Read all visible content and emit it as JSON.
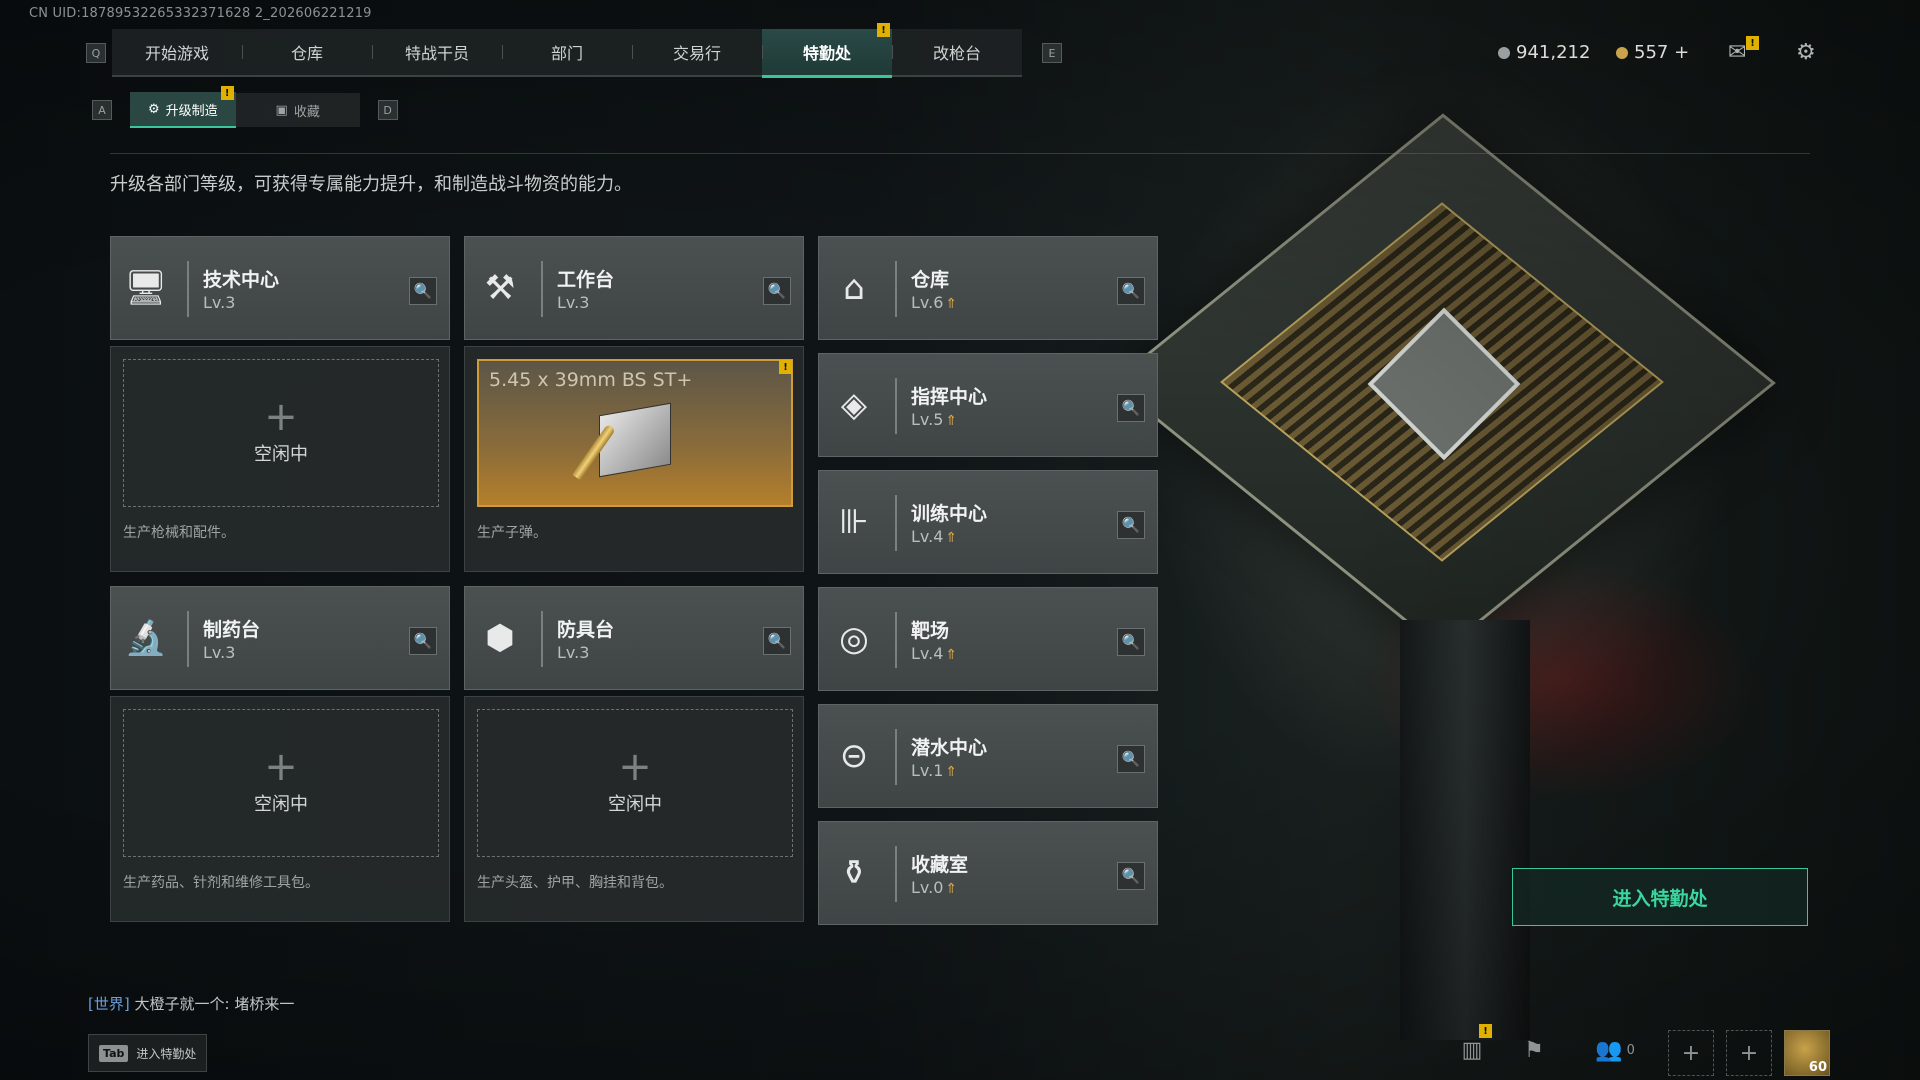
{
  "uid": "CN UID:18789532265332371628 2_202606221219",
  "nav": {
    "left_key": "Q",
    "right_key": "E",
    "tabs": [
      "开始游戏",
      "仓库",
      "特战干员",
      "部门",
      "交易行",
      "特勤处",
      "改枪台"
    ],
    "active_tab": "特勤处"
  },
  "currency": {
    "silver": "941,212",
    "gold": "557 +"
  },
  "subnav": {
    "left_key": "A",
    "right_key": "D",
    "tabs": [
      "升级制造",
      "收藏"
    ],
    "active": "升级制造"
  },
  "description": "升级各部门等级，可获得专属能力提升，和制造战斗物资的能力。",
  "departments": [
    {
      "name": "技术中心",
      "level": "Lv.3",
      "icon": "monitor-icon"
    },
    {
      "name": "工作台",
      "level": "Lv.3",
      "icon": "tools-icon"
    },
    {
      "name": "仓库",
      "level": "Lv.6",
      "icon": "warehouse-icon"
    },
    {
      "name": "指挥中心",
      "level": "Lv.5",
      "icon": "command-icon"
    },
    {
      "name": "训练中心",
      "level": "Lv.4",
      "icon": "dumbbell-icon"
    },
    {
      "name": "制药台",
      "level": "Lv.3",
      "icon": "microscope-icon"
    },
    {
      "name": "防具台",
      "level": "Lv.3",
      "icon": "cubes-icon"
    },
    {
      "name": "靶场",
      "level": "Lv.4",
      "icon": "target-icon"
    },
    {
      "name": "潜水中心",
      "level": "Lv.1",
      "icon": "goggles-icon"
    },
    {
      "name": "收藏室",
      "level": "Lv.0",
      "icon": "vault-icon"
    }
  ],
  "production": {
    "tech": {
      "slot": "空闲中",
      "text": "生产枪械和配件。"
    },
    "workbench": {
      "item": "5.45 x 39mm BS ST+",
      "text": "生产子弹。"
    },
    "pharmacy": {
      "slot": "空闲中",
      "text": "生产药品、针剂和维修工具包。"
    },
    "armor": {
      "slot": "空闲中",
      "text": "生产头盔、护甲、胸挂和背包。"
    }
  },
  "enter_button": "进入特勤处",
  "chat": {
    "channel": "[世界]",
    "message": "大橙子就一个: 堵桥来一"
  },
  "tab_hint": {
    "key": "Tab",
    "label": "进入特勤处"
  },
  "social_count": "0",
  "player_level": "60",
  "colors": {
    "accent": "#39c79a",
    "badge": "#e0b100",
    "ammo_border": "#d09c3a"
  }
}
